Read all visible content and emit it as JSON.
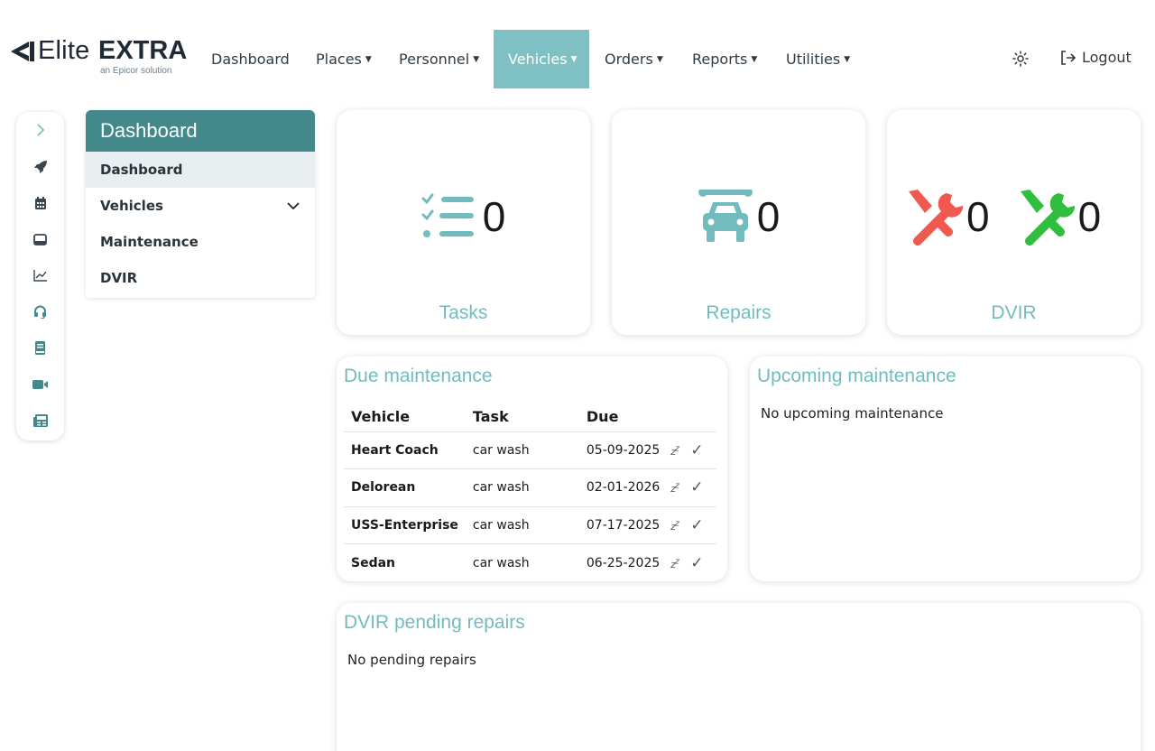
{
  "brand": {
    "elite": "Elite",
    "extra": "EXTRA",
    "subtitle": "an Epicor solution"
  },
  "nav": {
    "items": [
      {
        "label": "Dashboard",
        "dropdown": false
      },
      {
        "label": "Places",
        "dropdown": true
      },
      {
        "label": "Personnel",
        "dropdown": true
      },
      {
        "label": "Vehicles",
        "dropdown": true,
        "active": true
      },
      {
        "label": "Orders",
        "dropdown": true
      },
      {
        "label": "Reports",
        "dropdown": true
      },
      {
        "label": "Utilities",
        "dropdown": true
      }
    ],
    "theme_icon": "sun-icon",
    "logout_label": "Logout",
    "active_color": "#7ec0c3"
  },
  "rail": {
    "icons": [
      "chevron-right-icon",
      "rocket-icon",
      "calendar-icon",
      "inbox-icon",
      "chart-line-icon",
      "headset-icon",
      "book-icon",
      "video-icon",
      "newspaper-icon"
    ]
  },
  "submenu": {
    "title": "Dashboard",
    "items": [
      {
        "label": "Dashboard",
        "active": true
      },
      {
        "label": "Vehicles",
        "expandable": true
      },
      {
        "label": "Maintenance"
      },
      {
        "label": "DVIR"
      }
    ],
    "header_color": "#43898b"
  },
  "stats": {
    "tasks": {
      "count": "0",
      "label": "Tasks"
    },
    "repairs": {
      "count": "0",
      "label": "Repairs"
    },
    "dvir": {
      "failed_count": "0",
      "passed_count": "0",
      "label": "DVIR"
    },
    "accent": "#72bcc0",
    "fail_color": "#f0594f",
    "pass_color": "#2fbe3d"
  },
  "due_maintenance": {
    "title": "Due maintenance",
    "columns": [
      "Vehicle",
      "Task",
      "Due"
    ],
    "rows": [
      {
        "vehicle": "Heart Coach",
        "task": "car wash",
        "due": "05-09-2025"
      },
      {
        "vehicle": "Delorean",
        "task": "car wash",
        "due": "02-01-2026"
      },
      {
        "vehicle": "USS-Enterprise",
        "task": "car wash",
        "due": "07-17-2025"
      },
      {
        "vehicle": "Sedan",
        "task": "car wash",
        "due": "06-25-2025"
      }
    ]
  },
  "upcoming_maintenance": {
    "title": "Upcoming maintenance",
    "empty_text": "No upcoming maintenance"
  },
  "dvir_pending": {
    "title": "DVIR pending repairs",
    "empty_text": "No pending repairs"
  }
}
